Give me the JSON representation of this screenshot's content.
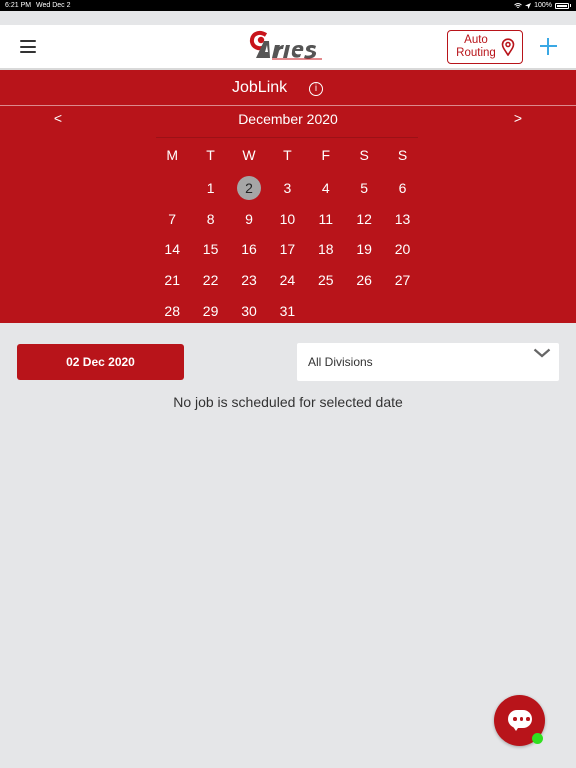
{
  "status_bar": {
    "time": "6:21 PM",
    "date": "Wed Dec 2",
    "battery": "100%"
  },
  "header": {
    "logo_text": "Aries",
    "auto_routing_label_1": "Auto",
    "auto_routing_label_2": "Routing"
  },
  "page": {
    "title": "JobLink",
    "info_glyph": "i"
  },
  "calendar": {
    "month_label": "December 2020",
    "prev": "<",
    "next": ">",
    "weekdays": [
      "M",
      "T",
      "W",
      "T",
      "F",
      "S",
      "S"
    ],
    "weeks": [
      [
        "",
        "1",
        "2",
        "3",
        "4",
        "5",
        "6"
      ],
      [
        "7",
        "8",
        "9",
        "10",
        "11",
        "12",
        "13"
      ],
      [
        "14",
        "15",
        "16",
        "17",
        "18",
        "19",
        "20"
      ],
      [
        "21",
        "22",
        "23",
        "24",
        "25",
        "26",
        "27"
      ],
      [
        "28",
        "29",
        "30",
        "31",
        "",
        "",
        ""
      ]
    ],
    "selected_day": "2"
  },
  "filters": {
    "selected_date": "02 Dec 2020",
    "division_value": "All Divisions"
  },
  "empty_message": "No job is scheduled for selected date",
  "colors": {
    "brand_red": "#b8141a",
    "accent_blue": "#3aa8e4",
    "online_green": "#31e020"
  },
  "icons": {
    "menu": "hamburger-menu-icon",
    "location": "location-pin-icon",
    "add": "plus-icon",
    "info": "info-icon",
    "dropdown": "chevron-down-icon",
    "chat": "chat-bubble-icon"
  }
}
